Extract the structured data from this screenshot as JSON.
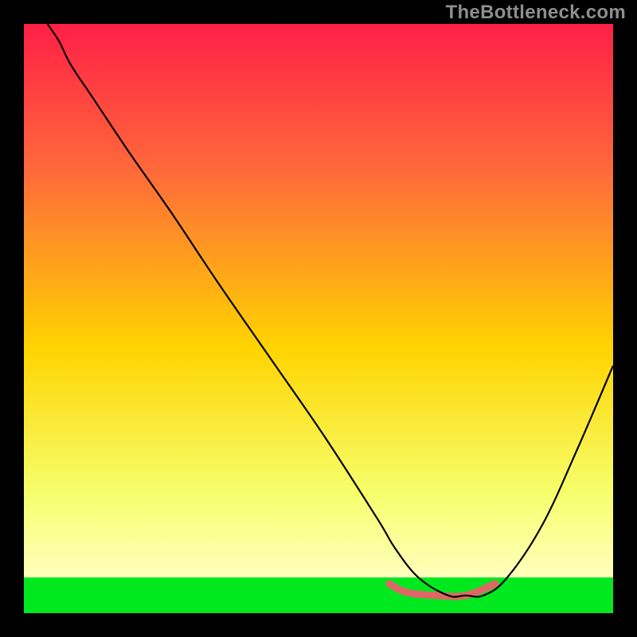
{
  "watermark": "TheBottleneck.com",
  "chart_data": {
    "type": "line",
    "title": "",
    "xlabel": "",
    "ylabel": "",
    "xlim": [
      0,
      100
    ],
    "ylim": [
      0,
      100
    ],
    "grid": false,
    "legend": false,
    "background_gradient_stops": [
      {
        "offset": 0.0,
        "color": "#ff1f47"
      },
      {
        "offset": 0.25,
        "color": "#ff6a3a"
      },
      {
        "offset": 0.55,
        "color": "#ffd400"
      },
      {
        "offset": 0.8,
        "color": "#f6ff6e"
      },
      {
        "offset": 0.939,
        "color": "#ffffbc"
      },
      {
        "offset": 0.94,
        "color": "#00e81e"
      },
      {
        "offset": 1.0,
        "color": "#00e81e"
      }
    ],
    "series": [
      {
        "name": "bottleneck-curve",
        "x": [
          4,
          6,
          8,
          12,
          18,
          25,
          33,
          42,
          51,
          60,
          63,
          67,
          72,
          75,
          78,
          82,
          88,
          94,
          100
        ],
        "values": [
          100,
          97,
          93,
          87,
          78,
          68,
          56,
          43,
          30,
          16,
          11,
          6,
          3,
          3,
          3,
          6,
          15,
          28,
          42
        ]
      }
    ],
    "accent_segment": {
      "name": "optimal-range",
      "x": [
        62,
        65,
        70,
        75,
        80
      ],
      "values": [
        5,
        3.5,
        3,
        3,
        5
      ]
    },
    "annotations": []
  }
}
